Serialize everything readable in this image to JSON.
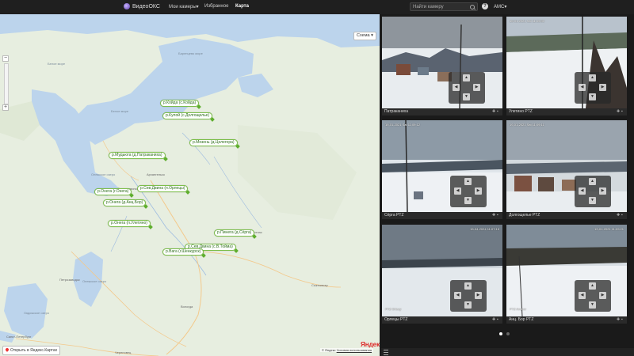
{
  "topnav": {
    "brand": "ВидеоОКС",
    "links": [
      {
        "label": "Мои камеры",
        "caret": "▾"
      },
      {
        "label": "Избранное"
      },
      {
        "label": "Карта"
      }
    ],
    "search_placeholder": "Найти камеру",
    "help": "?",
    "user": "АМС",
    "user_caret": "▾"
  },
  "map": {
    "layer_button": "Схема",
    "layer_caret": "▾",
    "open_in_maps": "Открыть в Яндекс.Картах",
    "copyright": "© Яндекс",
    "terms": "Условия использования",
    "logo": "Яндекс",
    "zoom_in": "−",
    "zoom_out": "+",
    "geo_labels": [
      "Баренцево море",
      "Белое море",
      "Белое море",
      "Онежское озеро",
      "Онежское озеро",
      "Архангельск",
      "Северодвинск",
      "Сыктывкар",
      "Петрозаводск",
      "Вологда",
      "Котлас",
      "Ладожское озеро",
      "Санкт-Петербург",
      "Череповец"
    ],
    "pins": [
      "р.Койда (с.Койда)",
      "р.Кулой (с.Долгощелье)",
      "р.Мезень (д.Целегора)",
      "р.Мудьюга (д.Патраканиха)",
      "р.Сев.Двина (п.Орлецы)",
      "р.Онега (г.Онега)",
      "р.Онега (д.Анц.Бор)",
      "р.Онега (п.Улетино)",
      "р.Пинега (д.Сёрга)",
      "р.Сев.Двина (с.В.Тойма)",
      "р.Вага (г.Шенкурск)"
    ]
  },
  "cameras": [
    {
      "name": "Патраканиха",
      "timestamp": "",
      "ptz": true
    },
    {
      "name": "Улетино PTZ",
      "timestamp": "19-01-2021 Sat 11:09:00",
      "ptz": true
    },
    {
      "name": "Сёрга PTZ",
      "timestamp": "19-01-2021 Sat 11:09:12",
      "ptz": true
    },
    {
      "name": "Долгощелье PTZ",
      "timestamp": "19-01-2021 Sat 11:09:11",
      "ptz": true
    },
    {
      "name": "Орлецы PTZ",
      "timestamp": "15-04-2024 11:07:15",
      "ptz": true,
      "overlay_text": "PTZ Orlecy"
    },
    {
      "name": "Анц. Бор PTZ",
      "timestamp": "19-01-2021 11:09:21",
      "ptz": true,
      "overlay_text": "PTZ Ancbor"
    }
  ],
  "pagination": {
    "total": 2,
    "active": 0
  },
  "colors": {
    "accent_pin": "#5fae2e",
    "water": "#bcd4ec",
    "land": "#e7eee0"
  }
}
